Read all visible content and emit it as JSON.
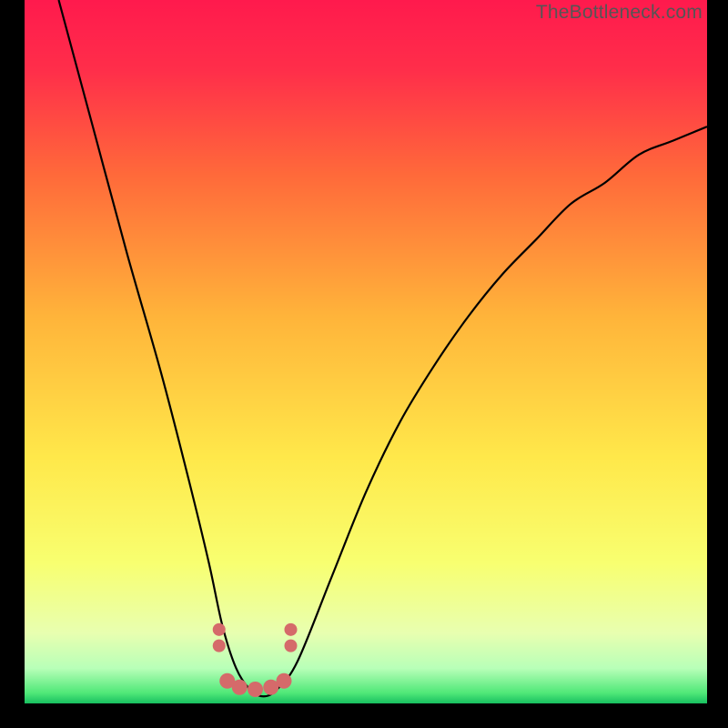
{
  "watermark": "TheBottleneck.com",
  "chart_data": {
    "type": "line",
    "title": "",
    "xlabel": "",
    "ylabel": "",
    "xlim": [
      0,
      100
    ],
    "ylim": [
      0,
      100
    ],
    "grid": false,
    "legend": false,
    "gradient_stops": [
      {
        "offset": 0.0,
        "color": "#ff1a4d"
      },
      {
        "offset": 0.1,
        "color": "#ff2e4a"
      },
      {
        "offset": 0.25,
        "color": "#ff6a3a"
      },
      {
        "offset": 0.45,
        "color": "#ffb43a"
      },
      {
        "offset": 0.65,
        "color": "#ffe84a"
      },
      {
        "offset": 0.8,
        "color": "#f8ff70"
      },
      {
        "offset": 0.9,
        "color": "#e8ffb0"
      },
      {
        "offset": 0.95,
        "color": "#b8ffb8"
      },
      {
        "offset": 0.985,
        "color": "#50e878"
      },
      {
        "offset": 1.0,
        "color": "#18c060"
      }
    ],
    "series": [
      {
        "name": "bottleneck-curve",
        "color": "#000000",
        "x": [
          5,
          10,
          15,
          20,
          24,
          27,
          29,
          31,
          33,
          35,
          37,
          40,
          45,
          50,
          55,
          60,
          65,
          70,
          75,
          80,
          85,
          90,
          95,
          100
        ],
        "values": [
          100,
          82,
          64,
          47,
          32,
          20,
          11,
          5,
          2,
          1,
          2,
          6,
          18,
          30,
          40,
          48,
          55,
          61,
          66,
          71,
          74,
          78,
          80,
          82
        ]
      }
    ],
    "markers": {
      "color": "#d56a6a",
      "radius_small": 7,
      "radius_large": 8.5,
      "points": [
        {
          "x": 28.5,
          "y": 10.5,
          "r": "small"
        },
        {
          "x": 28.5,
          "y": 8.2,
          "r": "small"
        },
        {
          "x": 39.0,
          "y": 10.5,
          "r": "small"
        },
        {
          "x": 39.0,
          "y": 8.2,
          "r": "small"
        },
        {
          "x": 29.7,
          "y": 3.2,
          "r": "large"
        },
        {
          "x": 31.5,
          "y": 2.3,
          "r": "large"
        },
        {
          "x": 33.8,
          "y": 2.0,
          "r": "large"
        },
        {
          "x": 36.1,
          "y": 2.3,
          "r": "large"
        },
        {
          "x": 38.0,
          "y": 3.2,
          "r": "large"
        }
      ]
    }
  }
}
